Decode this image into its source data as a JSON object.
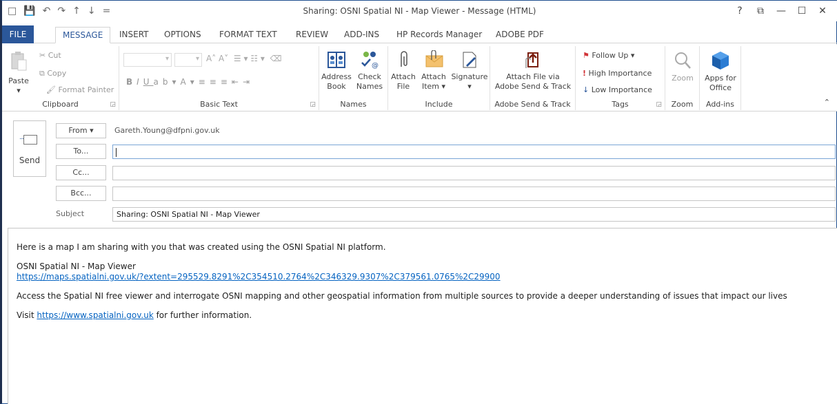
{
  "window": {
    "title": "Sharing: OSNI Spatial NI - Map Viewer  - Message (HTML)",
    "controls": [
      "?",
      "⧉",
      "—",
      "☐",
      "✕"
    ]
  },
  "qat": [
    "□",
    "💾",
    "↶",
    "↷",
    "↑",
    "↓",
    "="
  ],
  "tabs": [
    "FILE",
    "MESSAGE",
    "INSERT",
    "OPTIONS",
    "FORMAT TEXT",
    "REVIEW",
    "ADD-INS",
    "HP Records Manager",
    "ADOBE PDF"
  ],
  "ribbon": {
    "clipboard": {
      "label": "Clipboard",
      "paste": "Paste",
      "cut": "Cut",
      "copy": "Copy",
      "format_painter": "Format Painter"
    },
    "basic_text": {
      "label": "Basic Text"
    },
    "names": {
      "label": "Names",
      "address_book": [
        "Address",
        "Book"
      ],
      "check_names": [
        "Check",
        "Names"
      ]
    },
    "include": {
      "label": "Include",
      "attach_file": [
        "Attach",
        "File"
      ],
      "attach_item": [
        "Attach",
        "Item ▾"
      ],
      "signature": [
        "Signature",
        "▾"
      ]
    },
    "adobe": {
      "label": "Adobe Send & Track",
      "attach_via": [
        "Attach File via",
        "Adobe Send & Track"
      ]
    },
    "tags": {
      "label": "Tags",
      "follow_up": "Follow Up ▾",
      "high": "High Importance",
      "low": "Low Importance"
    },
    "zoom": {
      "label": "Zoom",
      "zoom": "Zoom"
    },
    "addins": {
      "label": "Add-ins",
      "apps": [
        "Apps for",
        "Office"
      ]
    }
  },
  "header": {
    "send": "Send",
    "from_btn": "From ▾",
    "from_value": "Gareth.Young@dfpni.gov.uk",
    "to_btn": "To...",
    "cc_btn": "Cc...",
    "bcc_btn": "Bcc...",
    "subject_label": "Subject",
    "subject_value": "Sharing:  OSNI Spatial NI - Map Viewer"
  },
  "body": {
    "line1": "Here is a map I am sharing with you that was created using the OSNI Spatial NI platform.",
    "map_title": "OSNI Spatial NI - Map Viewer",
    "map_link": "https://maps.spatialni.gov.uk/?extent=295529.8291%2C354510.2764%2C346329.9307%2C379561.0765%2C29900",
    "line3": "Access the Spatial NI free viewer and interrogate OSNI mapping and other geospatial information from multiple sources to provide a deeper understanding of issues that impact our lives",
    "visit_prefix": "Visit ",
    "visit_link": "https://www.spatialni.gov.uk",
    "visit_suffix": " for further information."
  }
}
